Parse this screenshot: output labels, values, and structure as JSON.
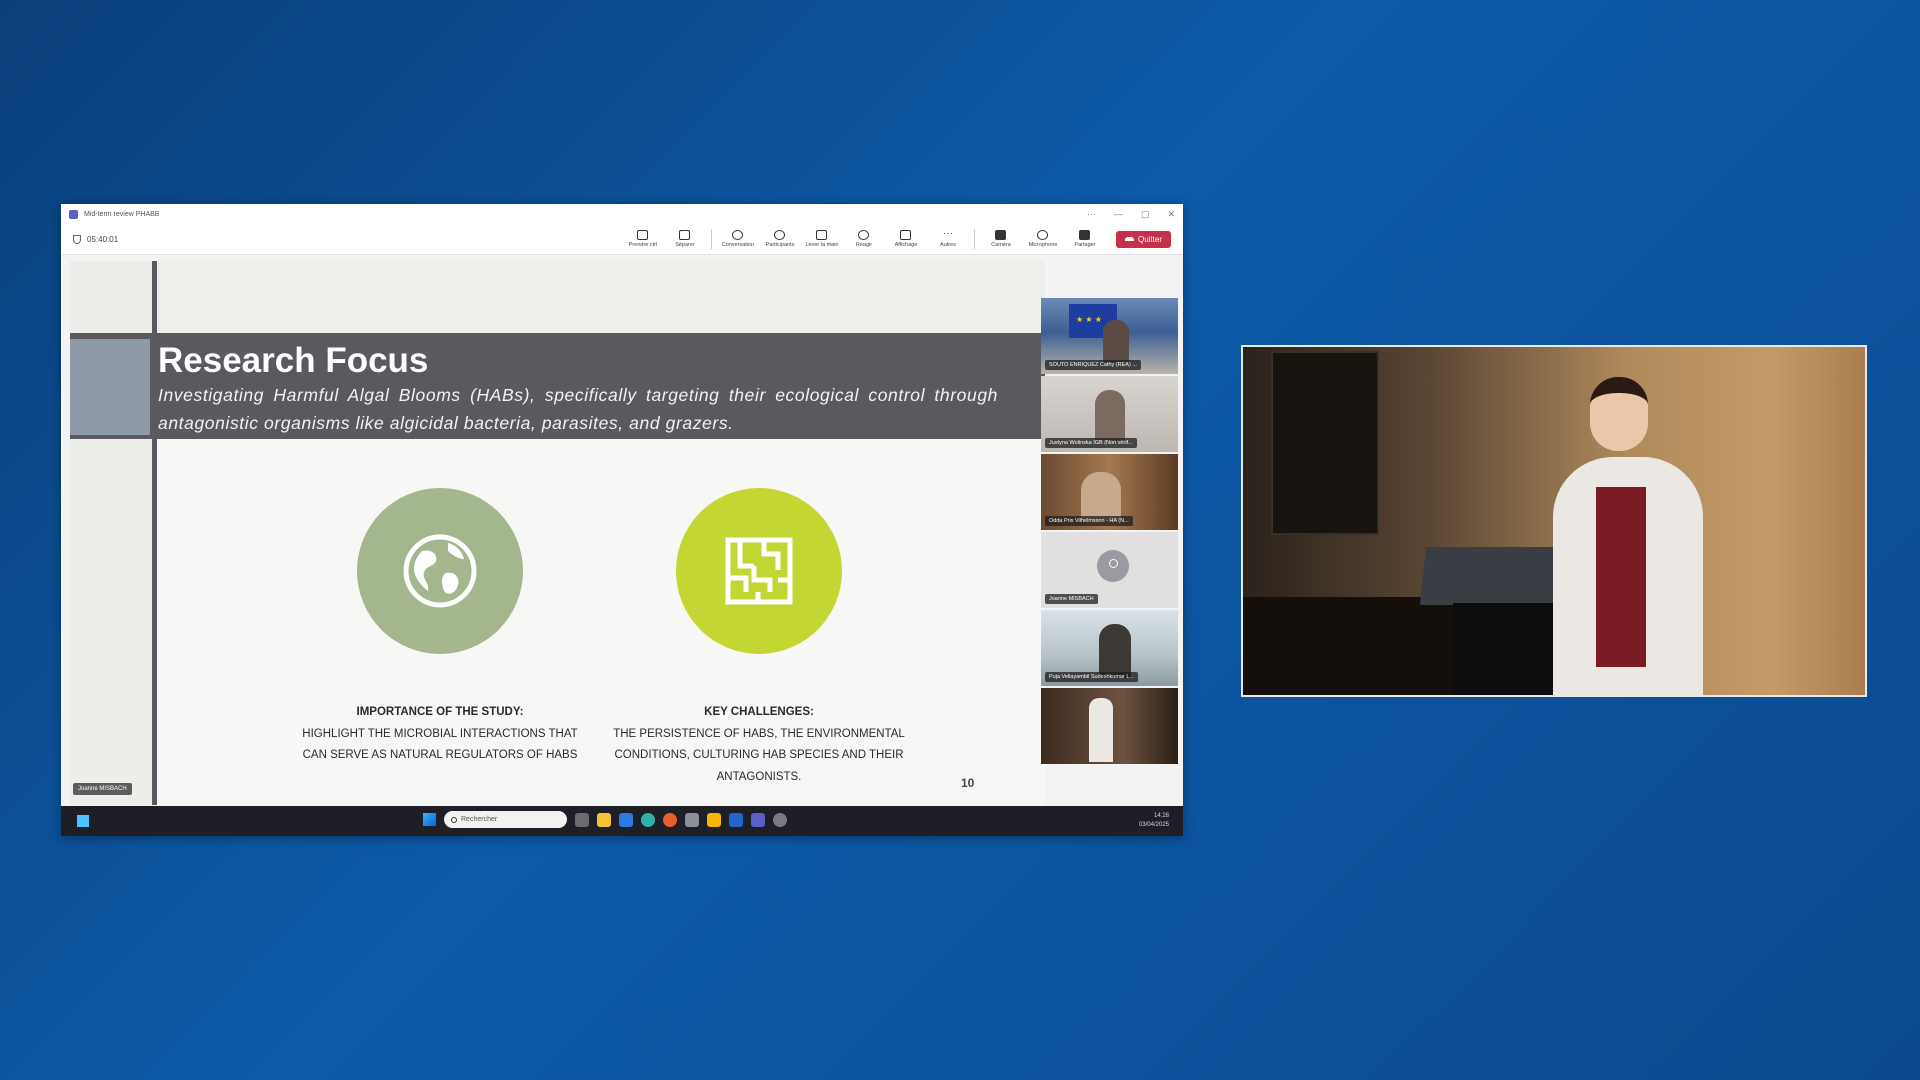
{
  "window": {
    "title": "Mid-term review PHABB",
    "timer": "05:40:01",
    "controls": [
      "···",
      "—",
      "▢",
      "✕"
    ]
  },
  "toolbar": {
    "items": [
      {
        "label": "Prendre ctrl",
        "icon": "screen-control-icon"
      },
      {
        "label": "Séparer",
        "icon": "pop-out-icon"
      },
      {
        "label": "Conversation",
        "icon": "chat-icon"
      },
      {
        "label": "Participants",
        "icon": "people-icon"
      },
      {
        "label": "Lever la main",
        "icon": "raise-hand-icon"
      },
      {
        "label": "Réagir",
        "icon": "react-icon"
      },
      {
        "label": "Affichage",
        "icon": "view-icon"
      },
      {
        "label": "Autres",
        "icon": "more-icon"
      },
      {
        "label": "Caméra",
        "icon": "camera-icon"
      },
      {
        "label": "Microphone",
        "icon": "microphone-icon"
      },
      {
        "label": "Partager",
        "icon": "share-icon"
      }
    ],
    "quit_label": "Quitter"
  },
  "slide": {
    "title": "Research Focus",
    "subtitle": "Investigating Harmful Algal Blooms (HABs), specifically targeting their ecological control through antagonistic organisms like algicidal bacteria, parasites, and grazers.",
    "left_heading": "IMPORTANCE OF THE STUDY:",
    "left_body": "HIGHLIGHT THE MICROBIAL INTERACTIONS THAT CAN SERVE AS NATURAL REGULATORS OF HABS",
    "right_heading": "KEY CHALLENGES:",
    "right_body": "THE PERSISTENCE OF HABS, THE ENVIRONMENTAL CONDITIONS, CULTURING HAB SPECIES AND THEIR ANTAGONISTS.",
    "page_number": "10",
    "presenter_tag": "Joanne MISBACH",
    "colors": {
      "band": "#5b5960",
      "globe_circle": "#a4b68e",
      "maze_circle": "#c4d633"
    }
  },
  "participants": [
    {
      "name": "SOUTO ENRIQUEZ Cathy (REA) ..."
    },
    {
      "name": "Justyna Wolinska IGB (Non vérif..."
    },
    {
      "name": "Odda Prix Vilhelmsson - HA (N..."
    },
    {
      "name": "Joanne MISBACH"
    },
    {
      "name": "Puja Vellayambil Sudeshkumar L..."
    },
    {
      "name": ""
    }
  ],
  "taskbar": {
    "search_placeholder": "Rechercher",
    "time": "14:28",
    "date": "03/04/2025"
  }
}
